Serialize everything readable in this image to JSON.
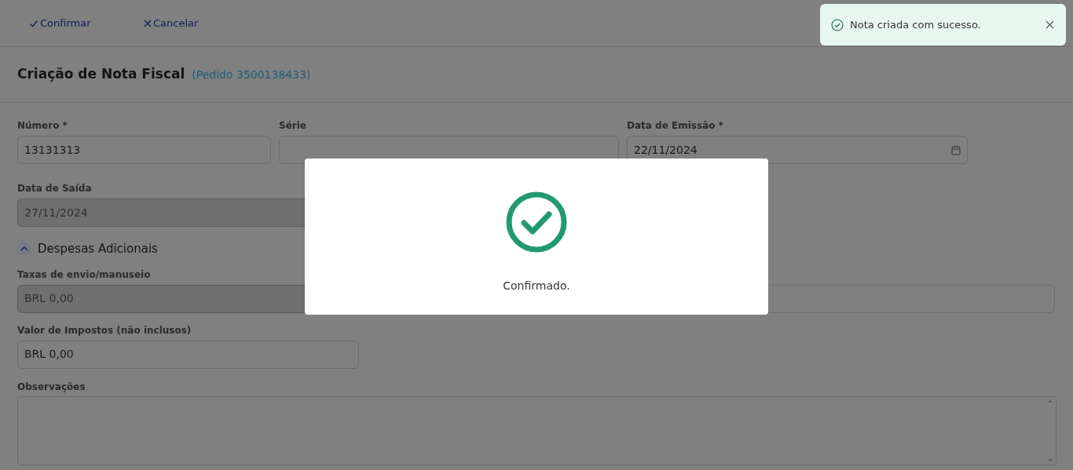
{
  "toolbar": {
    "buttons": [
      {
        "kind": "confirm",
        "label": "Confirmar"
      },
      {
        "kind": "cancel",
        "label": "Cancelar"
      }
    ]
  },
  "header": {
    "title": "Criação de Nota Fiscal",
    "subtitle": "(Pedido 3500138433)"
  },
  "main_fields": [
    {
      "label": "Número *",
      "value": "13131313",
      "kind": "text",
      "disabled": false
    },
    {
      "label": "Série",
      "kind": "text",
      "disabled": false
    },
    {
      "label": "Data de Emissão *",
      "value": "22/11/2024",
      "kind": "date",
      "disabled": false
    }
  ],
  "exit_date": {
    "label": "Data de Saída",
    "value": "27/11/2024",
    "kind": "text",
    "disabled": true
  },
  "section": {
    "title": "Despesas Adicionais",
    "expanded": true,
    "fields": [
      {
        "label": "Taxas de envio/manuseio",
        "value": "BRL 0,00",
        "kind": "text",
        "disabled": true
      },
      {
        "kind": "text",
        "disabled": false
      }
    ],
    "tax_field": {
      "label": "Valor de Impostos (não inclusos)",
      "value": "BRL 0,00",
      "kind": "text",
      "disabled": false
    }
  },
  "notes": {
    "label": "Observações"
  },
  "dialog": {
    "message": "Confirmado."
  },
  "toast": {
    "message": "Nota criada com sucesso."
  }
}
